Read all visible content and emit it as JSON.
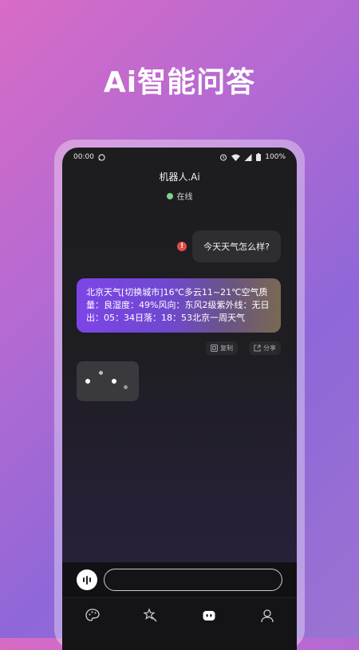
{
  "promo": {
    "headline": "Ai智能问答"
  },
  "status_bar": {
    "time": "00:00",
    "left_icons": [
      "whatsapp-icon"
    ],
    "right_icons": [
      "alarm-icon",
      "wifi-icon",
      "signal-icon",
      "battery-icon"
    ],
    "battery": "100%"
  },
  "header": {
    "title": "机器人.Ai",
    "status": "在线"
  },
  "messages": {
    "user_text": "今天天气怎么样?",
    "user_error_icon": "!",
    "bot_text": "北京天气[切换城市]16℃多云11~21℃空气质量：良湿度：49%风向：东风2级紫外线：无日出：05：34日落：18：53北京一周天气"
  },
  "actions": {
    "copy_label": "复制",
    "share_label": "分享"
  },
  "input": {
    "placeholder": ""
  },
  "tabs": [
    {
      "icon": "palette-icon"
    },
    {
      "icon": "magic-wand-icon"
    },
    {
      "icon": "robot-icon",
      "active": true
    },
    {
      "icon": "profile-icon"
    }
  ],
  "colors": {
    "online": "#7ed38b",
    "error": "#e24a4a",
    "bubble_gradient_start": "#7d45e8",
    "bubble_gradient_end": "#7a6852"
  }
}
